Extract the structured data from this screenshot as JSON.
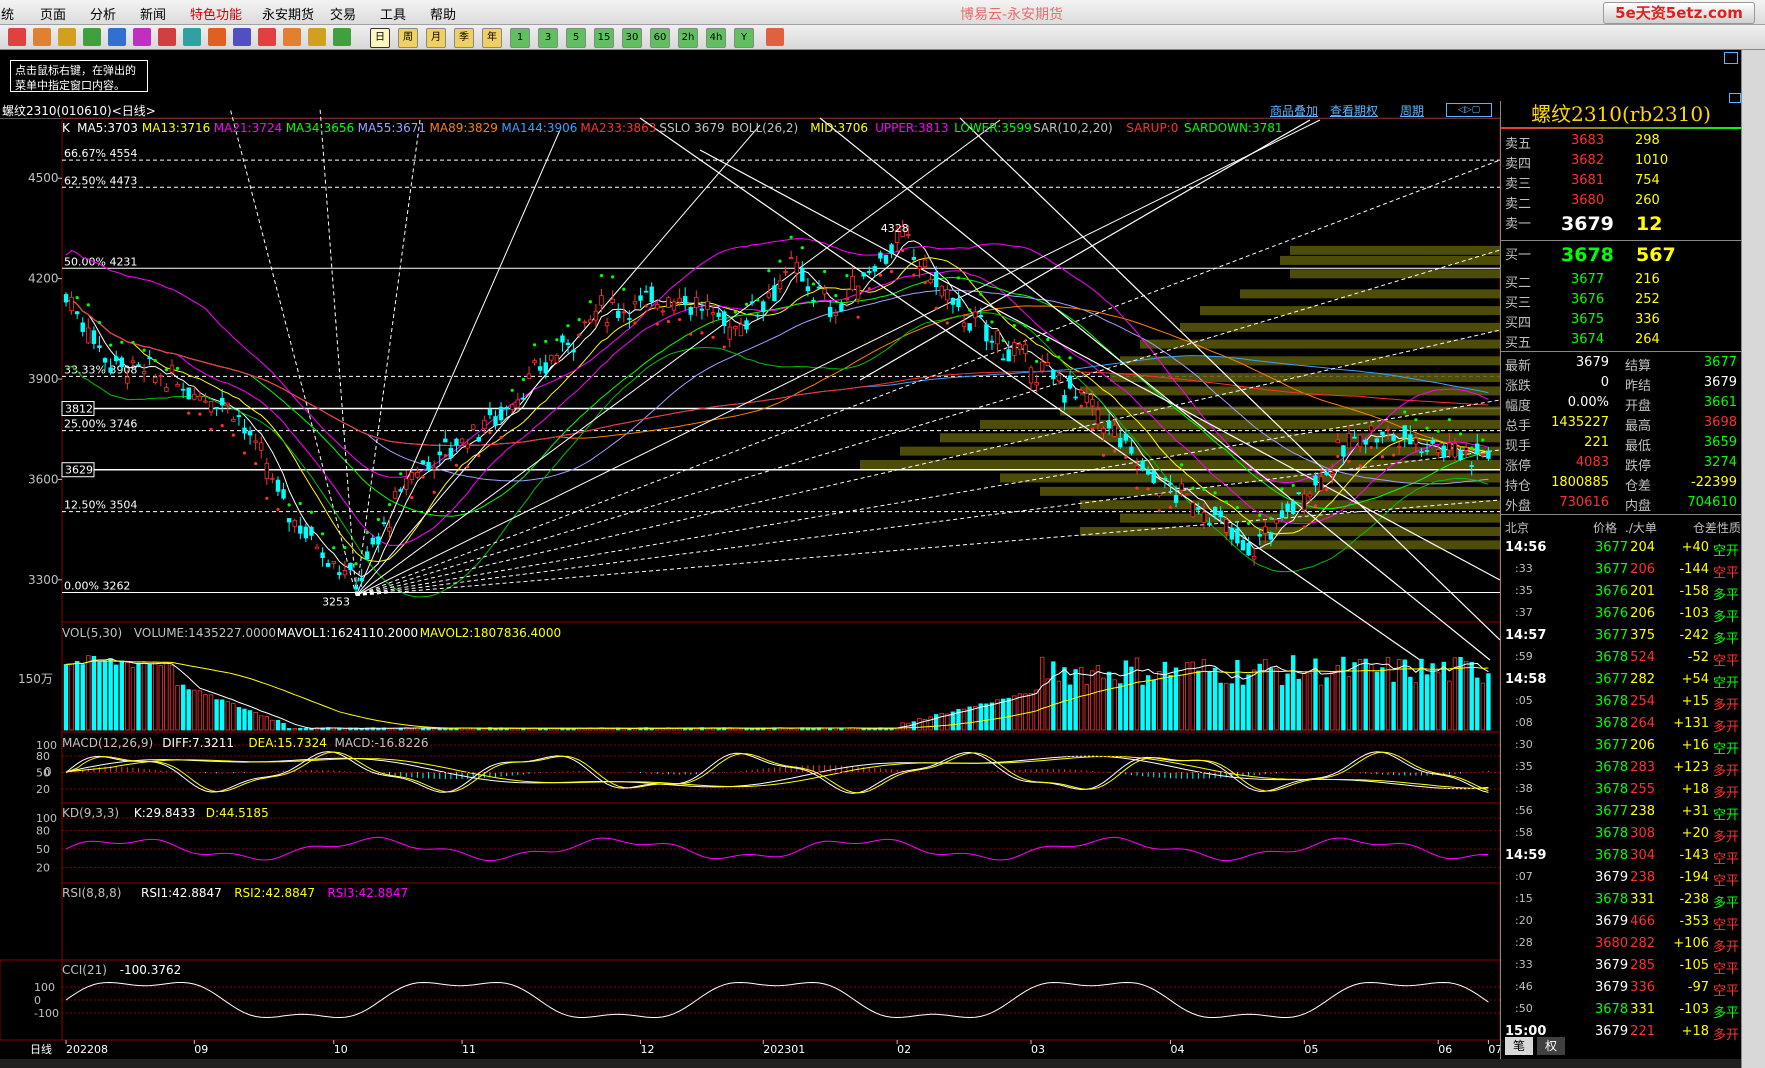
{
  "menu": [
    "系统",
    "页面",
    "分析",
    "新闻",
    "特色功能",
    "永安期货",
    "交易",
    "工具",
    "帮助"
  ],
  "menu_visible_first": "统",
  "app_title": "博易云-永安期货",
  "site_badge": "5e天资5etz.com",
  "toolbar_periods": [
    "日",
    "周",
    "月",
    "季",
    "年",
    "1",
    "3",
    "5",
    "15",
    "30",
    "60",
    "2h",
    "4h",
    "Y"
  ],
  "tip": "点击鼠标右键，在弹出的菜单中指定窗口内容。",
  "symbol_header": "螺纹2310(010610)<日线>",
  "header_links": [
    "商品叠加",
    "查看期权",
    "周期"
  ],
  "main_legend": [
    {
      "text": "K",
      "color": "#ffffff"
    },
    {
      "text": "MA5:3703",
      "color": "#ffffff"
    },
    {
      "text": "MA13:3716",
      "color": "#ffff00"
    },
    {
      "text": "MA21:3724",
      "color": "#ff00ff"
    },
    {
      "text": "MA34:3656",
      "color": "#00ff00"
    },
    {
      "text": "MA55:3671",
      "color": "#a0a0ff"
    },
    {
      "text": "MA89:3829",
      "color": "#ff8000"
    },
    {
      "text": "MA144:3906",
      "color": "#3aa0ff"
    },
    {
      "text": "MA233:3863",
      "color": "#ff3030"
    },
    {
      "text": "SSLO 3679",
      "color": "#c0c0c0"
    },
    {
      "text": "BOLL(26,2)",
      "color": "#c0c0c0"
    },
    {
      "text": "MID:3706",
      "color": "#ffff00"
    },
    {
      "text": "UPPER:3813",
      "color": "#ff00ff"
    },
    {
      "text": "LOWER:3599",
      "color": "#00ff00"
    },
    {
      "text": "SAR(10,2,20)",
      "color": "#c0c0c0"
    },
    {
      "text": "SARUP:0",
      "color": "#ff3030"
    },
    {
      "text": "SARDOWN:3781",
      "color": "#00ff00"
    }
  ],
  "price_axis": [
    "4500",
    "4200",
    "3900",
    "3600",
    "3300"
  ],
  "fib_levels": [
    "66.67%  4554",
    "62.50%  4473",
    "50.00%  4231",
    "33.33%  3908",
    "25.00%  3746",
    "12.50%  3504",
    "0.00%  3262"
  ],
  "price_boxes": [
    "3812",
    "3629"
  ],
  "annotations": {
    "high": "4328",
    "low": "3253"
  },
  "vol_title": [
    {
      "text": "VOL(5,30)",
      "color": "#c0c0c0"
    },
    {
      "text": "VOLUME:1435227.0000",
      "color": "#c0c0c0"
    },
    {
      "text": "MAVOL1:1624110.2000",
      "color": "#ffffff"
    },
    {
      "text": "MAVOL2:1807836.4000",
      "color": "#ffff00"
    }
  ],
  "vol_axis": "150万",
  "macd_title": [
    {
      "text": "MACD(12,26,9)",
      "color": "#c0c0c0"
    },
    {
      "text": "DIFF:7.3211",
      "color": "#ffffff"
    },
    {
      "text": "DEA:15.7324",
      "color": "#ffff00"
    },
    {
      "text": "MACD:-16.8226",
      "color": "#c0c0c0"
    }
  ],
  "macd_axis": [
    "0"
  ],
  "kd_title": [
    {
      "text": "KD(9,3,3)",
      "color": "#c0c0c0"
    },
    {
      "text": "K:29.8433",
      "color": "#ffffff"
    },
    {
      "text": "D:44.5185",
      "color": "#ffff00"
    }
  ],
  "kd_axis": [
    "100",
    "80",
    "50",
    "20"
  ],
  "rsi_title": [
    {
      "text": "RSI(8,8,8)",
      "color": "#c0c0c0"
    },
    {
      "text": "RSI1:42.8847",
      "color": "#ffffff"
    },
    {
      "text": "RSI2:42.8847",
      "color": "#ffff00"
    },
    {
      "text": "RSI3:42.8847",
      "color": "#ff00ff"
    }
  ],
  "rsi_axis": [
    "100",
    "80",
    "50",
    "20"
  ],
  "cci_title": [
    {
      "text": "CCI(21)",
      "color": "#c0c0c0"
    },
    {
      "text": "-100.3762",
      "color": "#ffffff"
    }
  ],
  "cci_axis": [
    "100",
    "0",
    "-100"
  ],
  "time_axis": [
    "日线",
    "202208",
    "09",
    "10",
    "11",
    "12",
    "202301",
    "02",
    "03",
    "04",
    "05",
    "06",
    "07"
  ],
  "quote": {
    "title": "螺纹2310(rb2310)",
    "asks": [
      {
        "label": "卖五",
        "price": "3683",
        "vol": "298"
      },
      {
        "label": "卖四",
        "price": "3682",
        "vol": "1010"
      },
      {
        "label": "卖三",
        "price": "3681",
        "vol": "754"
      },
      {
        "label": "卖二",
        "price": "3680",
        "vol": "260"
      },
      {
        "label": "卖一",
        "price": "3679",
        "vol": "12"
      }
    ],
    "bids": [
      {
        "label": "买一",
        "price": "3678",
        "vol": "567"
      },
      {
        "label": "买二",
        "price": "3677",
        "vol": "216"
      },
      {
        "label": "买三",
        "price": "3676",
        "vol": "252"
      },
      {
        "label": "买四",
        "price": "3675",
        "vol": "336"
      },
      {
        "label": "买五",
        "price": "3674",
        "vol": "264"
      }
    ],
    "stats": [
      {
        "l1": "最新",
        "v1": "3679",
        "c1": "#ffffff",
        "l2": "结算",
        "v2": "3677",
        "c2": "#00ff00"
      },
      {
        "l1": "涨跌",
        "v1": "0",
        "c1": "#ffffff",
        "l2": "昨结",
        "v2": "3679",
        "c2": "#ffffff"
      },
      {
        "l1": "幅度",
        "v1": "0.00%",
        "c1": "#ffffff",
        "l2": "开盘",
        "v2": "3661",
        "c2": "#00ff00"
      },
      {
        "l1": "总手",
        "v1": "1435227",
        "c1": "#ffff00",
        "l2": "最高",
        "v2": "3698",
        "c2": "#ff3030"
      },
      {
        "l1": "现手",
        "v1": "221",
        "c1": "#ffff00",
        "l2": "最低",
        "v2": "3659",
        "c2": "#00ff00"
      },
      {
        "l1": "涨停",
        "v1": "4083",
        "c1": "#ff3030",
        "l2": "跌停",
        "v2": "3274",
        "c2": "#00ff00"
      },
      {
        "l1": "持仓",
        "v1": "1800885",
        "c1": "#ffff00",
        "l2": "仓差",
        "v2": "-22399",
        "c2": "#ffff00"
      },
      {
        "l1": "外盘",
        "v1": "730616",
        "c1": "#ff3030",
        "l2": "内盘",
        "v2": "704610",
        "c2": "#00ff00"
      }
    ],
    "tick_header": [
      "北京",
      "价格",
      "./大单",
      "仓差",
      "性质"
    ],
    "ticks": [
      {
        "t": "14:56",
        "p": "3677",
        "pc": "#00ff00",
        "v": "204",
        "vc": "#ffff00",
        "d": "+40",
        "n": "空开",
        "nc": "#00ff00"
      },
      {
        "t": ":33",
        "p": "3677",
        "pc": "#00ff00",
        "v": "206",
        "vc": "#ff3030",
        "d": "-144",
        "n": "空平",
        "nc": "#ff3030"
      },
      {
        "t": ":35",
        "p": "3676",
        "pc": "#00ff00",
        "v": "201",
        "vc": "#ffff00",
        "d": "-158",
        "n": "多平",
        "nc": "#00ff00"
      },
      {
        "t": ":37",
        "p": "3676",
        "pc": "#00ff00",
        "v": "206",
        "vc": "#ffff00",
        "d": "-103",
        "n": "多平",
        "nc": "#00ff00"
      },
      {
        "t": "14:57",
        "p": "3677",
        "pc": "#00ff00",
        "v": "375",
        "vc": "#ffff00",
        "d": "-242",
        "n": "多平",
        "nc": "#00ff00"
      },
      {
        "t": ":59",
        "p": "3678",
        "pc": "#00ff00",
        "v": "524",
        "vc": "#ff3030",
        "d": "-52",
        "n": "空平",
        "nc": "#ff3030"
      },
      {
        "t": "14:58",
        "p": "3677",
        "pc": "#00ff00",
        "v": "282",
        "vc": "#ffff00",
        "d": "+54",
        "n": "空开",
        "nc": "#00ff00"
      },
      {
        "t": ":05",
        "p": "3678",
        "pc": "#00ff00",
        "v": "254",
        "vc": "#ff3030",
        "d": "+15",
        "n": "多开",
        "nc": "#ff3030"
      },
      {
        "t": ":08",
        "p": "3678",
        "pc": "#00ff00",
        "v": "264",
        "vc": "#ff3030",
        "d": "+131",
        "n": "多开",
        "nc": "#ff3030"
      },
      {
        "t": ":30",
        "p": "3677",
        "pc": "#00ff00",
        "v": "206",
        "vc": "#ffff00",
        "d": "+16",
        "n": "空开",
        "nc": "#00ff00"
      },
      {
        "t": ":35",
        "p": "3678",
        "pc": "#00ff00",
        "v": "283",
        "vc": "#ff3030",
        "d": "+123",
        "n": "多开",
        "nc": "#ff3030"
      },
      {
        "t": ":38",
        "p": "3678",
        "pc": "#00ff00",
        "v": "255",
        "vc": "#ff3030",
        "d": "+18",
        "n": "多开",
        "nc": "#ff3030"
      },
      {
        "t": ":56",
        "p": "3677",
        "pc": "#00ff00",
        "v": "238",
        "vc": "#ffff00",
        "d": "+31",
        "n": "空开",
        "nc": "#00ff00"
      },
      {
        "t": ":58",
        "p": "3678",
        "pc": "#00ff00",
        "v": "308",
        "vc": "#ff3030",
        "d": "+20",
        "n": "多开",
        "nc": "#ff3030"
      },
      {
        "t": "14:59",
        "p": "3678",
        "pc": "#00ff00",
        "v": "304",
        "vc": "#ff3030",
        "d": "-143",
        "n": "空平",
        "nc": "#ff3030"
      },
      {
        "t": ":07",
        "p": "3679",
        "pc": "#ffffff",
        "v": "238",
        "vc": "#ff3030",
        "d": "-194",
        "n": "空平",
        "nc": "#ff3030"
      },
      {
        "t": ":15",
        "p": "3678",
        "pc": "#00ff00",
        "v": "331",
        "vc": "#ffff00",
        "d": "-238",
        "n": "多平",
        "nc": "#00ff00"
      },
      {
        "t": ":20",
        "p": "3679",
        "pc": "#ffffff",
        "v": "466",
        "vc": "#ff3030",
        "d": "-353",
        "n": "空平",
        "nc": "#ff3030"
      },
      {
        "t": ":28",
        "p": "3680",
        "pc": "#ff3030",
        "v": "282",
        "vc": "#ff3030",
        "d": "+106",
        "n": "多开",
        "nc": "#ff3030"
      },
      {
        "t": ":33",
        "p": "3679",
        "pc": "#ffffff",
        "v": "285",
        "vc": "#ff3030",
        "d": "-105",
        "n": "空平",
        "nc": "#ff3030"
      },
      {
        "t": ":46",
        "p": "3679",
        "pc": "#ffffff",
        "v": "336",
        "vc": "#ff3030",
        "d": "-97",
        "n": "空平",
        "nc": "#ff3030"
      },
      {
        "t": ":50",
        "p": "3678",
        "pc": "#00ff00",
        "v": "331",
        "vc": "#ffff00",
        "d": "-103",
        "n": "多平",
        "nc": "#00ff00"
      },
      {
        "t": "15:00",
        "p": "3679",
        "pc": "#ffffff",
        "v": "221",
        "vc": "#ff3030",
        "d": "+18",
        "n": "多开",
        "nc": "#ff3030"
      }
    ],
    "tabs": [
      "笔",
      "权"
    ]
  },
  "colors": {
    "up": "#ff3030",
    "down": "#00ffff",
    "bg": "#000000",
    "grid": "#8b0000"
  },
  "chart_data": {
    "type": "candlestick",
    "start": "2022-08-01",
    "end": "2023-07-14",
    "range": [
      3253,
      4328
    ],
    "close_anchors": [
      [
        0,
        4150
      ],
      [
        8,
        3950
      ],
      [
        18,
        3900
      ],
      [
        30,
        3820
      ],
      [
        40,
        3500
      ],
      [
        52,
        3290
      ],
      [
        62,
        3620
      ],
      [
        78,
        3800
      ],
      [
        95,
        4100
      ],
      [
        110,
        4150
      ],
      [
        120,
        4050
      ],
      [
        130,
        4230
      ],
      [
        138,
        4100
      ],
      [
        145,
        4250
      ],
      [
        150,
        4320
      ],
      [
        160,
        4100
      ],
      [
        172,
        3950
      ],
      [
        182,
        3850
      ],
      [
        195,
        3600
      ],
      [
        205,
        3500
      ],
      [
        212,
        3380
      ],
      [
        222,
        3560
      ],
      [
        232,
        3740
      ],
      [
        242,
        3720
      ],
      [
        252,
        3680
      ]
    ],
    "high": 4328,
    "low": 3253
  }
}
